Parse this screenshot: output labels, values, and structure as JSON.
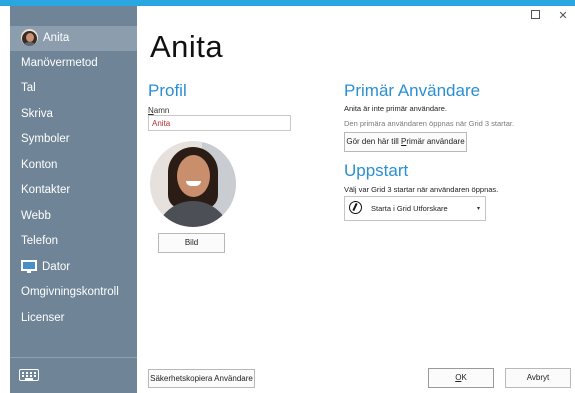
{
  "window": {
    "maximize_label": "",
    "close_label": "✕"
  },
  "sidebar": {
    "items": [
      {
        "label": "Anita"
      },
      {
        "label": "Manövermetod"
      },
      {
        "label": "Tal"
      },
      {
        "label": "Skriva"
      },
      {
        "label": "Symboler"
      },
      {
        "label": "Konton"
      },
      {
        "label": "Kontakter"
      },
      {
        "label": "Webb"
      },
      {
        "label": "Telefon"
      },
      {
        "label": "Dator"
      },
      {
        "label": "Omgivningskontroll"
      },
      {
        "label": "Licenser"
      }
    ],
    "keyboard_icon": "keyboard-icon"
  },
  "page": {
    "title": "Anita"
  },
  "profile": {
    "heading": "Profil",
    "name_label_first": "N",
    "name_label_rest": "amn",
    "name_value": "Anita",
    "photo_button": "Bild"
  },
  "primary_user": {
    "heading": "Primär Användare",
    "status": "Anita är inte primär användare.",
    "description": "Den primära användaren öppnas när Grid 3 startar.",
    "button_pre": "Gör den här till ",
    "button_underlined": "P",
    "button_post": "rimär användare"
  },
  "startup": {
    "heading": "Uppstart",
    "description": "Välj var Grid 3 startar när användaren öppnas.",
    "dropdown_value": "Starta i Grid Utforskare",
    "dropdown_icon": "compass-icon",
    "caret": "▾"
  },
  "footer": {
    "backup_button": "Säkerhetskopiera Användare",
    "ok_underlined": "O",
    "ok_rest": "K",
    "cancel_button": "Avbryt"
  },
  "colors": {
    "accent": "#2b8fd4",
    "sidebar_bg": "#6f8597",
    "sidebar_active": "#8c9eae",
    "top_bar": "#2aa6e0"
  }
}
